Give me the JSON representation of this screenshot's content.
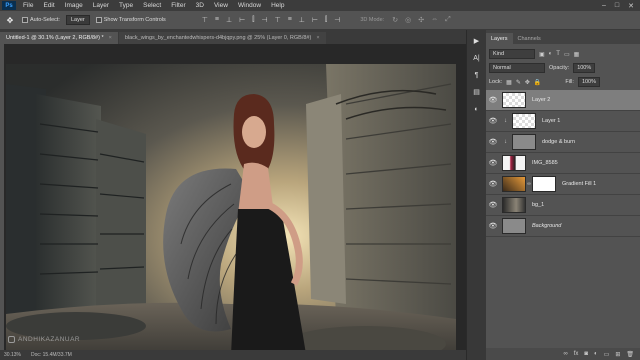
{
  "menubar": {
    "logo": "Ps",
    "items": [
      "File",
      "Edit",
      "Image",
      "Layer",
      "Type",
      "Select",
      "Filter",
      "3D",
      "View",
      "Window",
      "Help"
    ]
  },
  "options": {
    "auto_select_label": "Auto-Select:",
    "auto_select_value": "Layer",
    "transform_label": "Show Transform Controls",
    "mode_3d": "3D Mode:"
  },
  "tabs": [
    {
      "label": "Untitled-1 @ 30.1% (Layer 2, RGB/8#) *",
      "active": true
    },
    {
      "label": "black_wings_by_enchantedwhispers-d4bjqpy.png @ 25% (Layer 0, RGB/8#)",
      "active": false
    }
  ],
  "status": {
    "zoom": "30.13%",
    "doc": "Doc: 15.4M/33.7M"
  },
  "watermark": "ANDHIKAZANUAR",
  "panel": {
    "tabs": [
      "Layers",
      "Channels"
    ],
    "kind_label": "Kind",
    "blend_mode": "Normal",
    "opacity_label": "Opacity:",
    "opacity_value": "100%",
    "lock_label": "Lock:",
    "fill_label": "Fill:",
    "fill_value": "100%"
  },
  "layers": [
    {
      "name": "Layer 2",
      "selected": true
    },
    {
      "name": "Layer 1",
      "selected": false
    },
    {
      "name": "dodge & burn",
      "selected": false
    },
    {
      "name": "IMG_8585",
      "selected": false
    },
    {
      "name": "Gradient Fill 1",
      "selected": false
    },
    {
      "name": "bg_1",
      "selected": false
    },
    {
      "name": "Background",
      "selected": false
    }
  ],
  "colors": {
    "accent": "#3aa0ff",
    "panel_bg": "#535353",
    "selected_layer": "#7e7e7e"
  }
}
